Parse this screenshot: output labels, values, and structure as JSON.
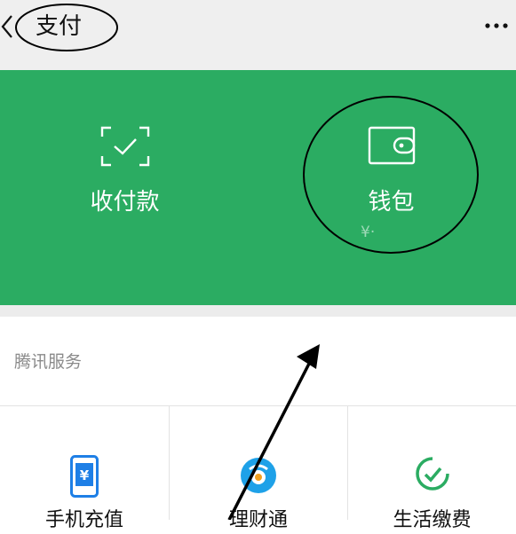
{
  "navbar": {
    "title": "支付",
    "back_icon": "chevron-left-icon",
    "more_icon": "more-dots-icon"
  },
  "panel": {
    "background": "#2bac62",
    "items": [
      {
        "label": "收付款",
        "icon": "scan-qr-icon"
      },
      {
        "label": "钱包",
        "icon": "wallet-icon",
        "balance": "¥·"
      }
    ]
  },
  "services": {
    "title": "腾讯服务",
    "items": [
      {
        "label": "手机充值",
        "icon": "phone-recharge-icon",
        "color": "#1e7fe6"
      },
      {
        "label": "理财通",
        "icon": "wealth-icon",
        "color": "#1ea1e8"
      },
      {
        "label": "生活缴费",
        "icon": "utility-bill-icon",
        "color": "#2bac62"
      }
    ]
  },
  "annotations": {
    "ellipse_color": "#000000",
    "arrow_color": "#000000"
  }
}
